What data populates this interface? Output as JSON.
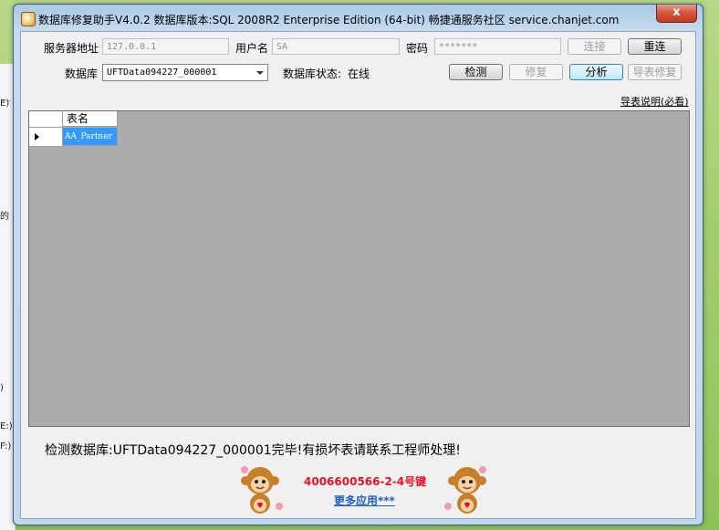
{
  "window": {
    "title": "数据库修复助手V4.0.2 数据库版本:SQL 2008R2 Enterprise Edition (64-bit)  畅捷通服务社区 service.chanjet.com",
    "close_label": "x"
  },
  "form": {
    "server_label": "服务器地址",
    "server_value": "127.0.0.1",
    "user_label": "用户名",
    "user_value": "SA",
    "password_label": "密码",
    "password_value": "*******",
    "db_label": "数据库",
    "db_selected": "UFTData094227_000001",
    "db_status_label": "数据库状态:",
    "db_status_value": "在线"
  },
  "buttons": {
    "connect": "连接",
    "reconnect": "重连",
    "check": "检测",
    "repair": "修复",
    "analyze": "分析",
    "export_repair": "导表修复"
  },
  "export_help_link": "导表说明(必看)",
  "table": {
    "columns": [
      "表名"
    ],
    "rows": [
      "AA_Partner"
    ]
  },
  "status_message": "检测数据库:UFTData094227_000001完毕!有损坏表请联系工程师处理!",
  "footer": {
    "hotline": "4006600566-2-4号键",
    "more_apps": "更多应用***"
  },
  "background": {
    "left_fragments": [
      "E)",
      "的",
      ")",
      "E:)",
      "F:)"
    ]
  }
}
